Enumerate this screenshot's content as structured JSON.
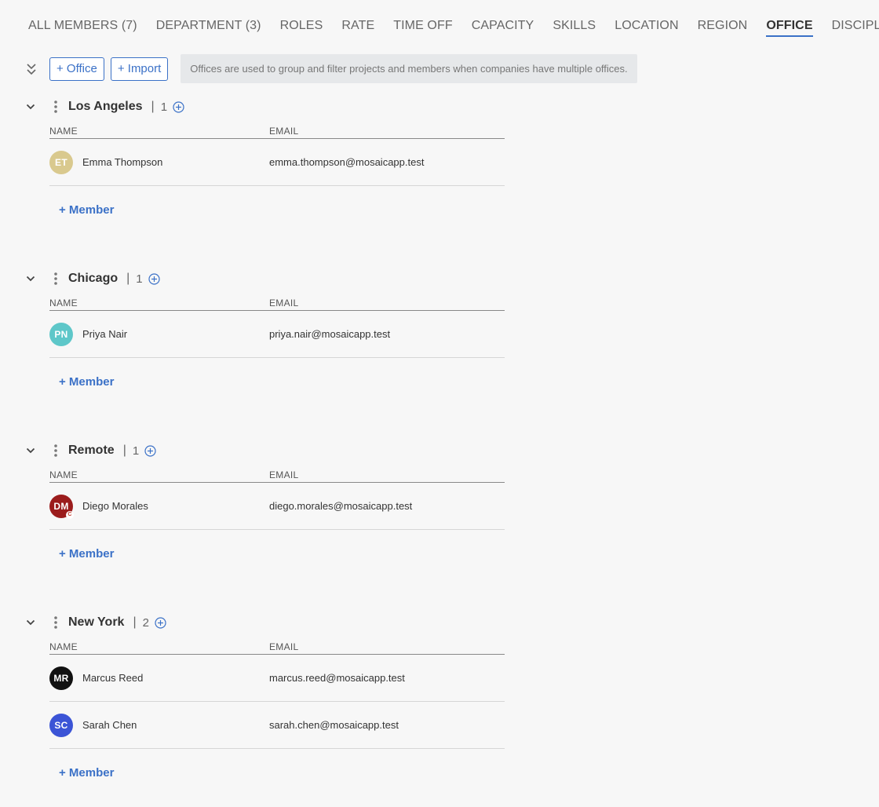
{
  "tabs": [
    {
      "label": "ALL MEMBERS (7)",
      "active": false
    },
    {
      "label": "DEPARTMENT (3)",
      "active": false
    },
    {
      "label": "ROLES",
      "active": false
    },
    {
      "label": "RATE",
      "active": false
    },
    {
      "label": "TIME OFF",
      "active": false
    },
    {
      "label": "CAPACITY",
      "active": false
    },
    {
      "label": "SKILLS",
      "active": false
    },
    {
      "label": "LOCATION",
      "active": false
    },
    {
      "label": "REGION",
      "active": false
    },
    {
      "label": "OFFICE",
      "active": true
    },
    {
      "label": "DISCIPLINE",
      "active": false
    }
  ],
  "toolbar": {
    "add_office_label": "+ Office",
    "import_label": "+ Import",
    "info_text": "Offices are used to group and filter projects and members when companies have multiple offices."
  },
  "columns": {
    "name": "NAME",
    "email": "EMAIL"
  },
  "add_member_label": "+ Member",
  "separator": "|",
  "accent_color": "#3b71c7",
  "groups": [
    {
      "name": "Los Angeles",
      "count": "1",
      "members": [
        {
          "initials": "ET",
          "name": "Emma Thompson",
          "email": "emma.thompson@mosaicapp.test",
          "color": "#d9c98e",
          "badge": ""
        }
      ]
    },
    {
      "name": "Chicago",
      "count": "1",
      "members": [
        {
          "initials": "PN",
          "name": "Priya Nair",
          "email": "priya.nair@mosaicapp.test",
          "color": "#5ec7c9",
          "badge": ""
        }
      ]
    },
    {
      "name": "Remote",
      "count": "1",
      "members": [
        {
          "initials": "DM",
          "name": "Diego Morales",
          "email": "diego.morales@mosaicapp.test",
          "color": "#9b1c1c",
          "badge": "C"
        }
      ]
    },
    {
      "name": "New York",
      "count": "2",
      "members": [
        {
          "initials": "MR",
          "name": "Marcus Reed",
          "email": "marcus.reed@mosaicapp.test",
          "color": "#111111",
          "badge": ""
        },
        {
          "initials": "SC",
          "name": "Sarah Chen",
          "email": "sarah.chen@mosaicapp.test",
          "color": "#3b54d6",
          "badge": ""
        }
      ]
    }
  ]
}
